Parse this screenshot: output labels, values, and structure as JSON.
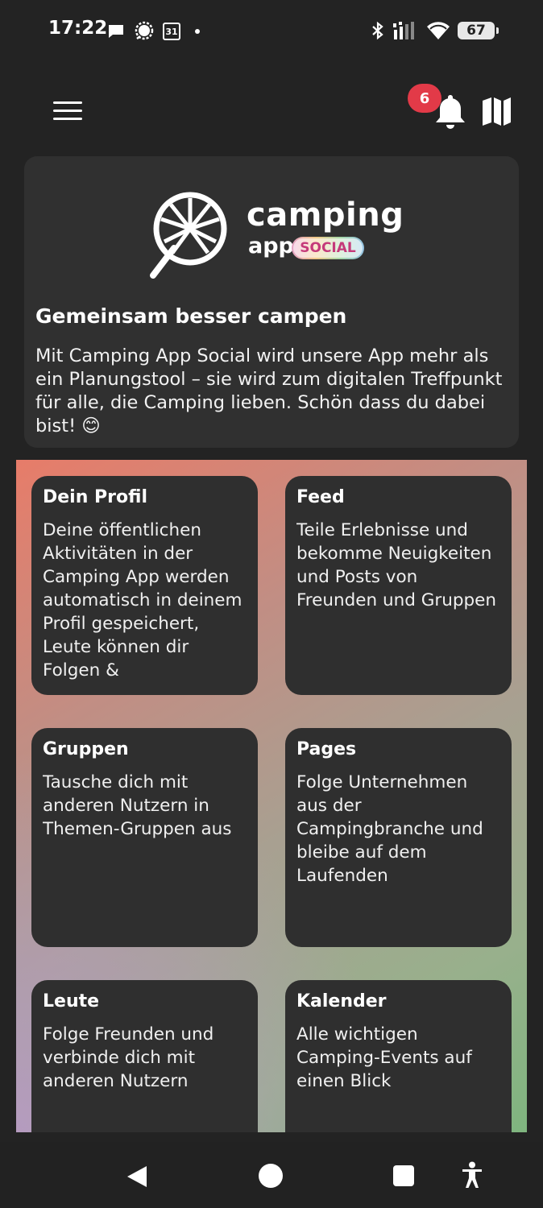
{
  "status_bar": {
    "time": "17:22",
    "calendar_day": "31",
    "battery": "67",
    "left_icons": [
      "message-icon",
      "chat-bubble-icon",
      "calendar-icon",
      "dot-icon"
    ],
    "right_icons": [
      "bluetooth-icon",
      "signal-icon",
      "wifi-icon",
      "battery-icon"
    ]
  },
  "header": {
    "notification_count": "6",
    "icons": [
      "hamburger-menu-icon",
      "bell-icon",
      "map-icon"
    ]
  },
  "intro": {
    "logo": {
      "word1": "camping",
      "word2": "app",
      "tag": "SOCIAL"
    },
    "title": "Gemeinsam besser campen",
    "text": "Mit Camping App Social wird unsere App mehr als ein Planungstool – sie wird zum digitalen Treffpunkt für alle, die Camping lieben. Schön dass du dabei bist! 😊"
  },
  "tiles": [
    {
      "title": "Dein Profil",
      "text": "Deine öffentlichen Aktivitäten in der Camping App werden automatisch in deinem Profil gespeichert, Leute können dir Folgen &"
    },
    {
      "title": "Feed",
      "text": "Teile Erlebnisse und bekomme Neuigkeiten und Posts von Freunden und Gruppen"
    },
    {
      "title": "Gruppen",
      "text": "Tausche dich mit anderen Nutzern in Themen-Gruppen aus"
    },
    {
      "title": "Pages",
      "text": "Folge Unternehmen aus der Campingbranche und bleibe auf dem Laufenden"
    },
    {
      "title": "Leute",
      "text": "Folge Freunden und verbinde dich mit anderen Nutzern"
    },
    {
      "title": "Kalender",
      "text": "Alle wichtigen Camping-Events auf einen Blick"
    }
  ],
  "colors": {
    "background": "#232323",
    "card": "#303030",
    "tile": "#2f2f2f",
    "badge": "#e23a48",
    "gradient_start": "#e77c69",
    "gradient_end": "#7fb57f"
  },
  "nav_bar": {
    "icons": [
      "back-icon",
      "home-icon",
      "recents-icon",
      "accessibility-icon"
    ]
  }
}
